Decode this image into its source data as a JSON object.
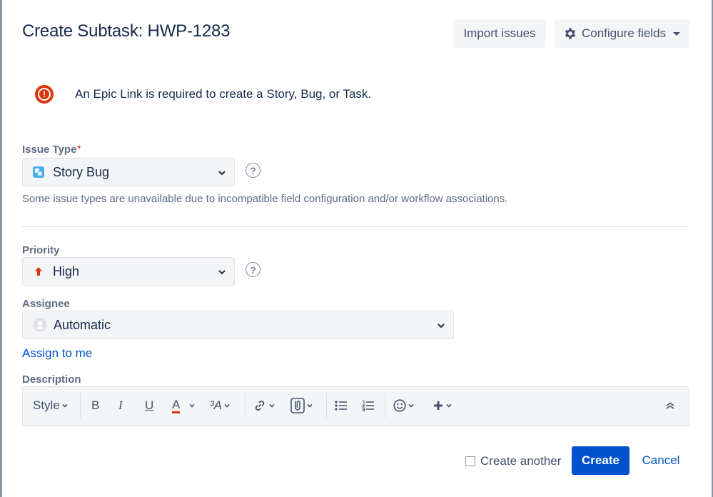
{
  "dialog": {
    "title": "Create Subtask: HWP-1283",
    "import_label": "Import issues",
    "configure_label": "Configure fields"
  },
  "error": {
    "message": "An Epic Link is required to create a Story, Bug, or Task.",
    "icon": "error-icon",
    "color": "#de350b"
  },
  "issue_type": {
    "label": "Issue Type",
    "required_mark": "*",
    "value": "Story Bug",
    "hint": "Some issue types are unavailable due to incompatible field configuration and/or workflow associations."
  },
  "priority": {
    "label": "Priority",
    "value": "High",
    "icon_color": "#de350b"
  },
  "assignee": {
    "label": "Assignee",
    "value": "Automatic",
    "assign_to_me": "Assign to me"
  },
  "description": {
    "label": "Description",
    "style_label": "Style",
    "bold": "B",
    "italic": "I",
    "underline": "U",
    "text_color": "A",
    "more_format": "³A"
  },
  "footer": {
    "create_another": "Create another",
    "create_label": "Create",
    "cancel_label": "Cancel"
  },
  "colors": {
    "primary": "#0052cc",
    "text": "#172b4d",
    "subtle": "#5e6c84",
    "field_bg": "#f4f5f7"
  }
}
